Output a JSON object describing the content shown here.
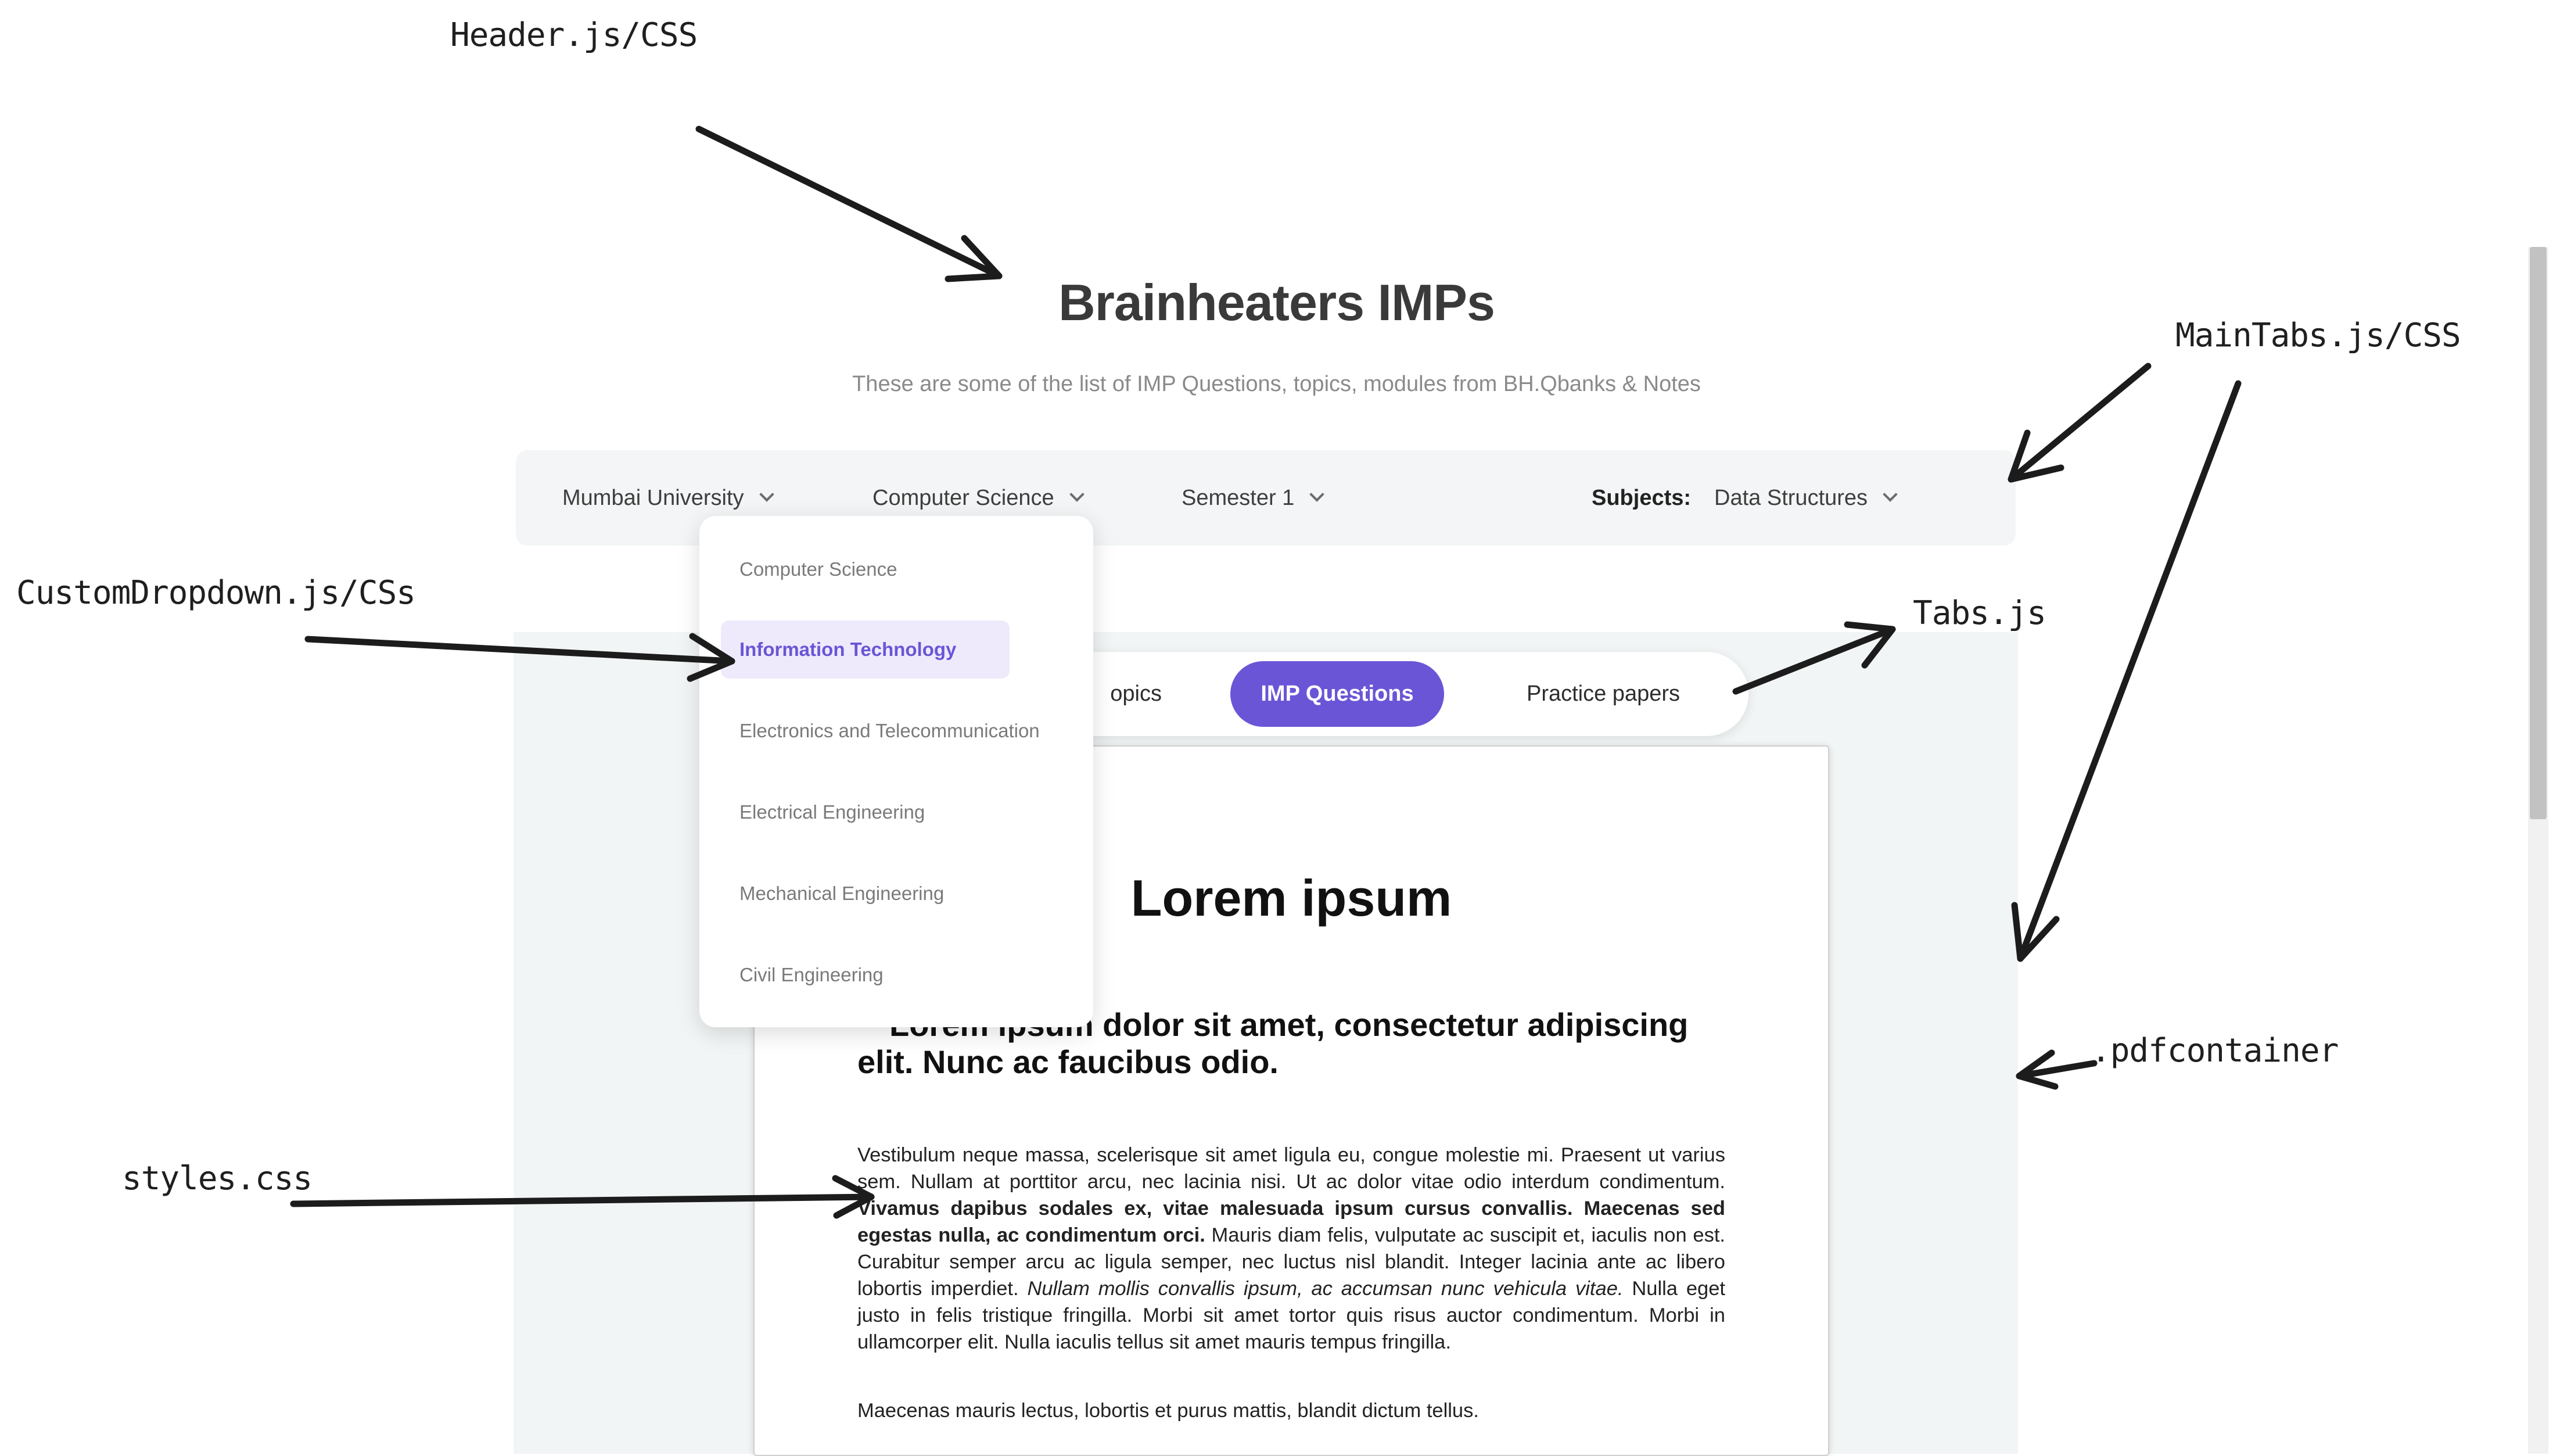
{
  "annotations": {
    "header": "Header.js/CSS",
    "main_tabs": "MainTabs.js/CSS",
    "dropdown": "CustomDropdown.js/CSs",
    "tabs": "Tabs.js",
    "pdfcontainer": ".pdfcontainer",
    "styles": "styles.css"
  },
  "header": {
    "title": "Brainheaters IMPs",
    "subtitle": "These are some of the list of IMP Questions, topics, modules from BH.Qbanks & Notes"
  },
  "main_tabs": {
    "university": "Mumbai University",
    "branch": "Computer Science",
    "semester": "Semester 1",
    "subjects_label": "Subjects:",
    "subject": "Data Structures"
  },
  "dropdown": {
    "options": [
      "Computer Science",
      "Information Technology",
      "Electronics and Telecommunication",
      "Electrical Engineering",
      "Mechanical Engineering",
      "Civil Engineering"
    ],
    "highlighted": "Information Technology"
  },
  "tabs": {
    "items": [
      "Topics",
      "IMP Questions",
      "Practice papers"
    ],
    "visible_partial": "opics",
    "active": "IMP Questions"
  },
  "document": {
    "heading": "Lorem ipsum",
    "subheading": "Lorem ipsum dolor sit amet, consectetur adipiscing elit. Nunc ac faucibus odio.",
    "para1_a": "Vestibulum neque massa, scelerisque sit amet ligula eu, congue molestie mi. Praesent ut varius sem. Nullam at porttitor arcu, nec lacinia nisi. Ut ac dolor vitae odio interdum condimentum. ",
    "para1_bold": "Vivamus dapibus sodales ex, vitae malesuada ipsum cursus convallis. Maecenas sed egestas nulla, ac condimentum orci.",
    "para1_b": " Mauris diam felis, vulputate ac suscipit et, iaculis non est. Curabitur semper arcu ac ligula semper, nec luctus nisl blandit. Integer lacinia ante ac libero lobortis imperdiet. ",
    "para1_italic": "Nullam mollis convallis ipsum, ac accumsan nunc vehicula vitae.",
    "para1_c": " Nulla eget justo in felis tristique fringilla. Morbi sit amet tortor quis risus auctor condimentum. Morbi in ullamcorper elit. Nulla iaculis tellus sit amet mauris tempus fringilla.",
    "para2": "Maecenas mauris lectus, lobortis et purus mattis, blandit dictum tellus."
  },
  "colors": {
    "accent": "#6a55d6",
    "highlight_bg": "#eeeafc",
    "panel_bg": "#f3f5f6"
  }
}
